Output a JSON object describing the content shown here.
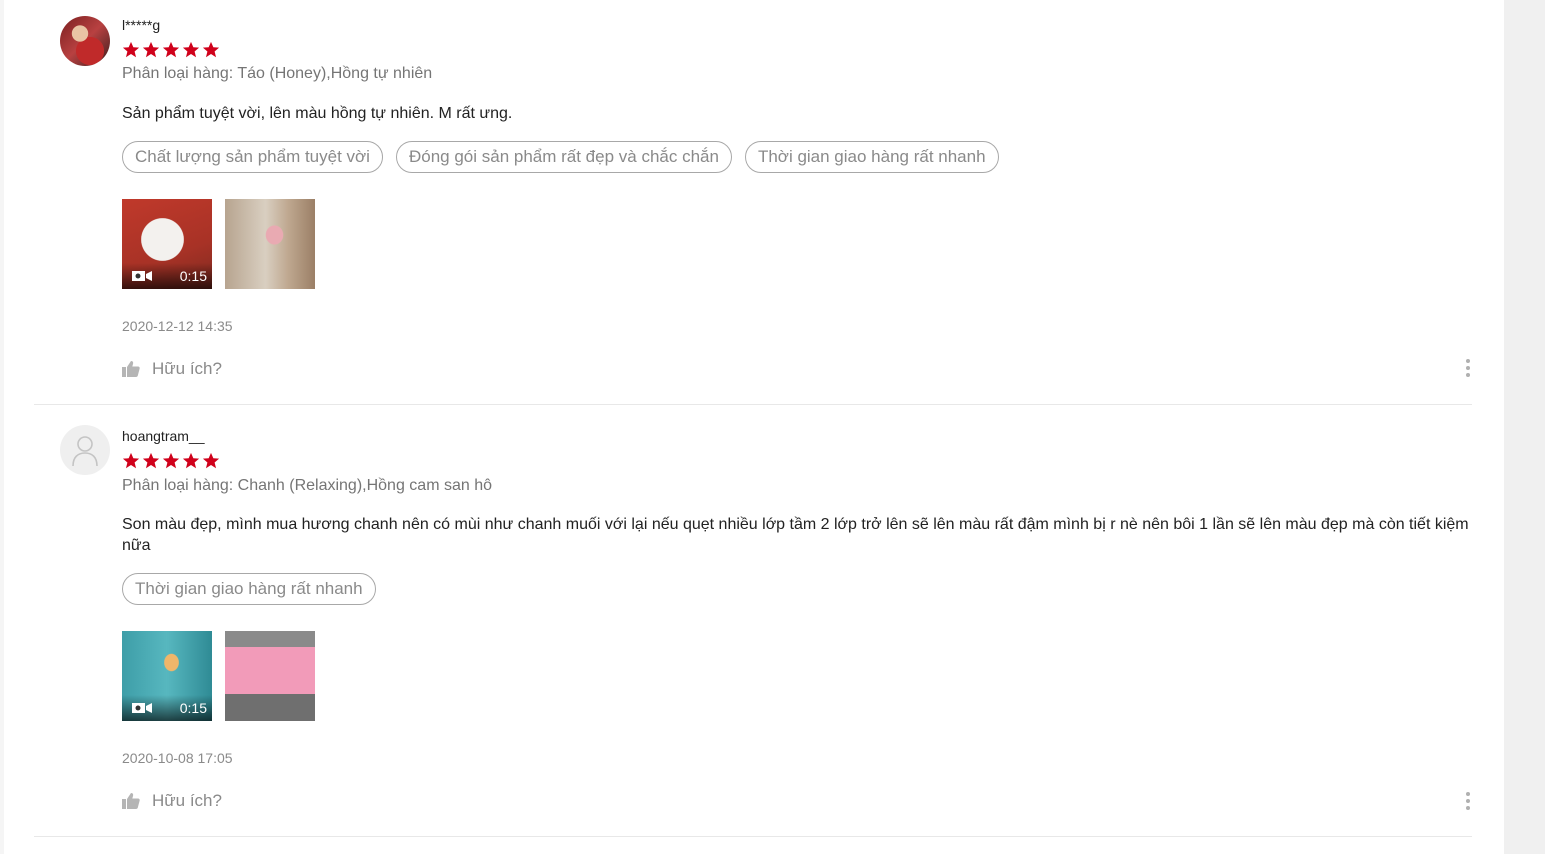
{
  "reviews": [
    {
      "username": "l*****g",
      "rating": 5,
      "variation": "Phân loại hàng: Táo (Honey),Hồng tự nhiên",
      "content": "Sản phẩm tuyệt vời, lên màu hồng tự nhiên. M rất ưng.",
      "tags": [
        "Chất lượng sản phẩm tuyệt vời",
        "Đóng gói sản phẩm rất đẹp và chắc chắn",
        "Thời gian giao hàng rất nhanh"
      ],
      "video_duration": "0:15",
      "time": "2020-12-12 14:35",
      "helpful": "Hữu ích?"
    },
    {
      "username": "hoangtram__",
      "rating": 5,
      "variation": "Phân loại hàng: Chanh (Relaxing),Hồng cam san hô",
      "content": "Son màu đẹp, mình mua hương chanh nên có mùi như chanh muối với lại nếu quẹt nhiều lớp tầm 2 lớp trở lên sẽ lên màu rất đậm mình bị r nè nên bôi 1 lần sẽ lên màu đẹp mà còn tiết kiệm nữa",
      "tags": [
        "Thời gian giao hàng rất nhanh"
      ],
      "video_duration": "0:15",
      "time": "2020-10-08 17:05",
      "helpful": "Hữu ích?"
    }
  ],
  "colors": {
    "star": "#d0011b",
    "tag_border": "#a8a8a8",
    "muted_text": "#8a8a8a"
  },
  "icons": {
    "star": "star-icon",
    "video": "video-camera-icon",
    "like": "thumbs-up-icon",
    "more": "more-vertical-icon",
    "avatar": "user-placeholder-icon"
  }
}
